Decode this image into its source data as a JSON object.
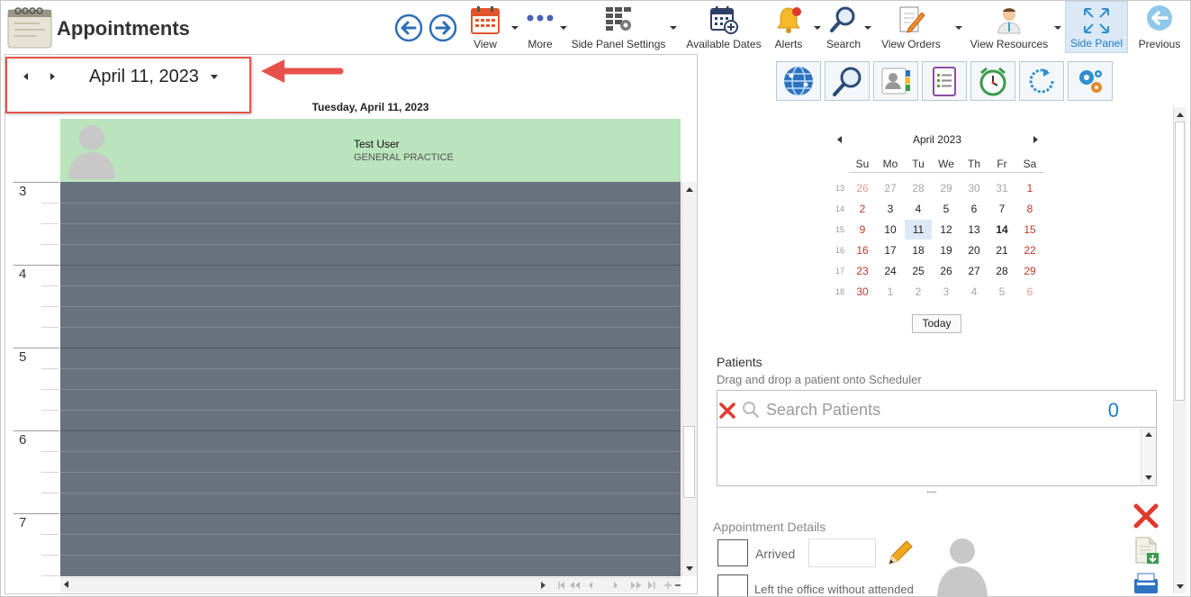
{
  "app": {
    "title": "Appointments"
  },
  "ribbon": {
    "view": "View",
    "more": "More",
    "side_panel_settings": "Side Panel Settings",
    "available_dates": "Available Dates",
    "alerts": "Alerts",
    "search": "Search",
    "view_orders": "View Orders",
    "view_resources": "View Resources",
    "side_panel": "Side Panel",
    "previous": "Previous"
  },
  "scheduler": {
    "date_selector": "April 11, 2023",
    "day_header": "Tuesday, April 11, 2023",
    "resource_name": "Test User",
    "resource_specialty": "GENERAL PRACTICE",
    "hours": [
      "3",
      "4",
      "5",
      "6",
      "7"
    ]
  },
  "calendar": {
    "month_label": "April 2023",
    "days_of_week": [
      "Su",
      "Mo",
      "Tu",
      "We",
      "Th",
      "Fr",
      "Sa"
    ],
    "weeks": [
      {
        "wk": "13",
        "days": [
          "26",
          "27",
          "28",
          "29",
          "30",
          "31",
          "1"
        ]
      },
      {
        "wk": "14",
        "days": [
          "2",
          "3",
          "4",
          "5",
          "6",
          "7",
          "8"
        ]
      },
      {
        "wk": "15",
        "days": [
          "9",
          "10",
          "11",
          "12",
          "13",
          "14",
          "15"
        ]
      },
      {
        "wk": "16",
        "days": [
          "16",
          "17",
          "18",
          "19",
          "20",
          "21",
          "22"
        ]
      },
      {
        "wk": "17",
        "days": [
          "23",
          "24",
          "25",
          "26",
          "27",
          "28",
          "29"
        ]
      },
      {
        "wk": "18",
        "days": [
          "30",
          "1",
          "2",
          "3",
          "4",
          "5",
          "6"
        ]
      }
    ],
    "selected_day": "11",
    "today_day": "14",
    "today_button": "Today"
  },
  "patients": {
    "title": "Patients",
    "hint": "Drag and drop a patient onto Scheduler",
    "search_placeholder": "Search Patients",
    "count": "0",
    "splitter": "......"
  },
  "appointment_details": {
    "title": "Appointment Details",
    "arrived_label": "Arrived",
    "left_office_label": "Left the office without attended"
  },
  "colors": {
    "accent": "#1e7fcb",
    "resource_header_bg": "#b9e4bc",
    "schedule_bg": "#68737f",
    "annotation_red": "#e5524a"
  }
}
